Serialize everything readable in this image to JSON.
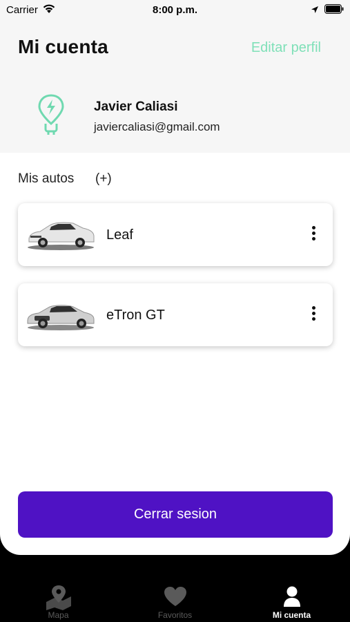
{
  "status_bar": {
    "carrier": "Carrier",
    "time": "8:00 p.m."
  },
  "header": {
    "title": "Mi cuenta",
    "edit_label": "Editar perfil"
  },
  "profile": {
    "name": "Javier Caliasi",
    "email": "javiercaliasi@gmail.com"
  },
  "cars_section": {
    "title": "Mis autos",
    "add_label": "(+)"
  },
  "cars": [
    {
      "name": "Leaf"
    },
    {
      "name": "eTron GT"
    }
  ],
  "logout_label": "Cerrar sesion",
  "tabs": [
    {
      "label": "Mapa",
      "icon": "map-pin-icon"
    },
    {
      "label": "Favoritos",
      "icon": "heart-icon"
    },
    {
      "label": "Mi cuenta",
      "icon": "user-icon"
    }
  ],
  "colors": {
    "accent": "#7fe0b8",
    "primary": "#4f12c4"
  }
}
